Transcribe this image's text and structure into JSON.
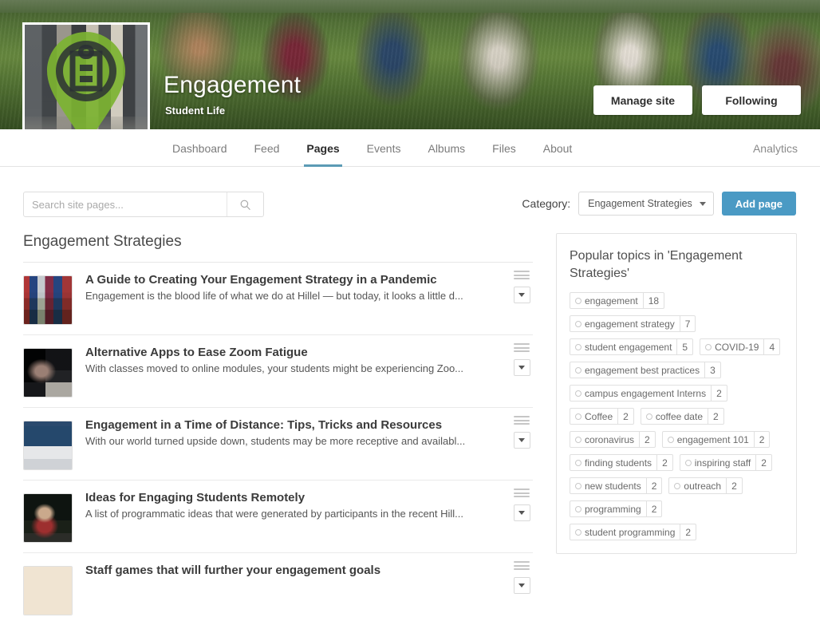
{
  "banner": {
    "title": "Engagement",
    "subtitle": "Student Life",
    "star_icon": "star-outline-icon",
    "manage_label": "Manage site",
    "following_label": "Following",
    "avatar_icon": "map-pin-logo-icon"
  },
  "nav": {
    "tabs": [
      {
        "label": "Dashboard",
        "active": false
      },
      {
        "label": "Feed",
        "active": false
      },
      {
        "label": "Pages",
        "active": true
      },
      {
        "label": "Events",
        "active": false
      },
      {
        "label": "Albums",
        "active": false
      },
      {
        "label": "Files",
        "active": false
      },
      {
        "label": "About",
        "active": false
      }
    ],
    "analytics_label": "Analytics",
    "accent_color": "#5b9bb5"
  },
  "toolbar": {
    "search_placeholder": "Search site pages...",
    "search_value": "",
    "search_icon": "search-icon",
    "category_label": "Category:",
    "category_value": "Engagement Strategies",
    "add_page_label": "Add page",
    "add_page_color": "#4a9ac4"
  },
  "main": {
    "section_title": "Engagement Strategies",
    "pages": [
      {
        "title": "A Guide to Creating Your Engagement Strategy in a Pandemic",
        "desc": "Engagement is the blood life of what we do at Hillel — but today, it looks a little d...",
        "thumb": "group-of-students-photo"
      },
      {
        "title": "Alternative Apps to Ease Zoom Fatigue",
        "desc": "With classes moved to online modules, your students might be experiencing Zoo...",
        "thumb": "student-at-laptop-photo"
      },
      {
        "title": "Engagement in a Time of Distance: Tips, Tricks and Resources",
        "desc": "With our world turned upside down, students may be more receptive and availabl...",
        "thumb": "video-call-laptop-photo"
      },
      {
        "title": "Ideas for Engaging Students Remotely",
        "desc": "A list of programmatic ideas that were generated by participants in the recent Hill...",
        "thumb": "person-in-red-hoodie-photo"
      },
      {
        "title": "Staff games that will further your engagement goals",
        "desc": "",
        "thumb": "cat-photo"
      }
    ],
    "drag_handle_icon": "drag-handle-icon",
    "row_menu_icon": "chevron-down-icon"
  },
  "sidebar": {
    "title": "Popular topics in 'Engagement Strategies'",
    "tags": [
      {
        "label": "engagement",
        "count": "18"
      },
      {
        "label": "engagement strategy",
        "count": "7"
      },
      {
        "label": "student engagement",
        "count": "5"
      },
      {
        "label": "COVID-19",
        "count": "4"
      },
      {
        "label": "engagement best practices",
        "count": "3"
      },
      {
        "label": "campus engagement Interns",
        "count": "2"
      },
      {
        "label": "Coffee",
        "count": "2"
      },
      {
        "label": "coffee date",
        "count": "2"
      },
      {
        "label": "coronavirus",
        "count": "2"
      },
      {
        "label": "engagement 101",
        "count": "2"
      },
      {
        "label": "finding students",
        "count": "2"
      },
      {
        "label": "inspiring staff",
        "count": "2"
      },
      {
        "label": "new students",
        "count": "2"
      },
      {
        "label": "outreach",
        "count": "2"
      },
      {
        "label": "programming",
        "count": "2"
      },
      {
        "label": "student programming",
        "count": "2"
      }
    ],
    "tag_icon": "tag-circle-icon"
  }
}
